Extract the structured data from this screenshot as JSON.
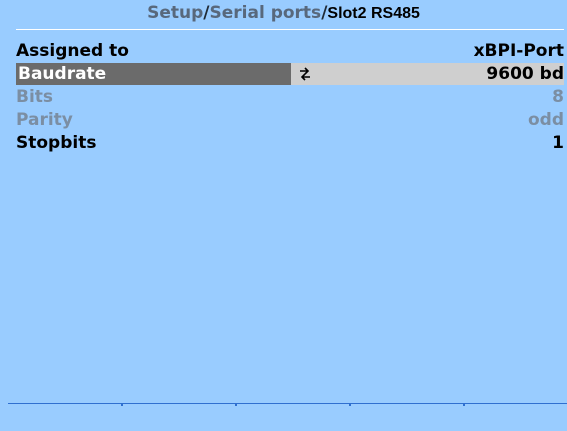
{
  "breadcrumb": {
    "path": "Setup",
    "separator": "/",
    "section": "Serial ports",
    "current": "Slot2 RS485"
  },
  "rows": [
    {
      "label": "Assigned to",
      "value": "xBPI-Port",
      "state": "normal"
    },
    {
      "label": "Baudrate",
      "value": "9600 bd",
      "state": "selected",
      "icon": "swap-arrows-icon"
    },
    {
      "label": "Bits",
      "value": "8",
      "state": "disabled"
    },
    {
      "label": "Parity",
      "value": "odd",
      "state": "disabled"
    },
    {
      "label": "Stopbits",
      "value": "1",
      "state": "normal"
    }
  ],
  "softkeys": [
    "",
    "",
    "",
    "",
    ""
  ],
  "colors": {
    "background": "#99ccff",
    "selected_label_bg": "#6b6b6b",
    "selected_value_bg": "#cfcfcf",
    "disabled_text": "#7b8ea3",
    "softkey_rule": "#2f6fd0"
  }
}
